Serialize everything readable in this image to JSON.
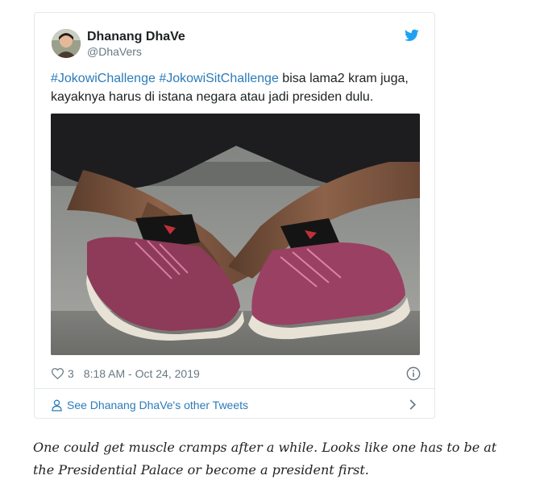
{
  "tweet": {
    "author_name": "Dhanang DhaVe",
    "author_handle": "@DhaVers",
    "hashtags": [
      "#JokowiChallenge",
      "#JokowiSitChallenge"
    ],
    "text_line1_rest": " bisa lama2 kram juga,",
    "text_line2": "kayaknya harus di istana negara atau jadi presiden dulu.",
    "likes": "3",
    "timestamp": "8:18 AM - Oct 24, 2019",
    "see_more": "See Dhanang DhaVe's other Tweets",
    "icons": {
      "brand": "twitter-bird-icon",
      "like": "heart-icon",
      "info": "info-icon",
      "profile": "person-icon",
      "more": "chevron-right-icon"
    },
    "colors": {
      "link": "#2b7bb9",
      "brand": "#1da1f2",
      "muted": "#697882"
    }
  },
  "article": {
    "caption": "One could get muscle cramps after a while. Looks like one has to be at the Presidential Palace or become a president first."
  }
}
